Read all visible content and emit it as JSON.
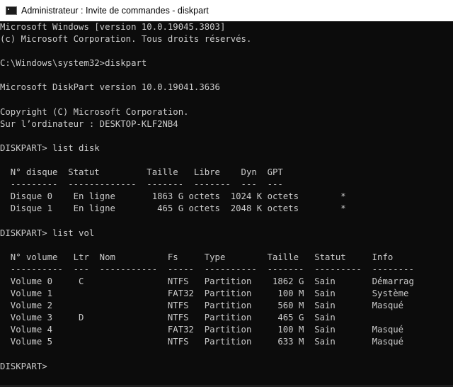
{
  "window": {
    "title": "Administrateur : Invite de commandes - diskpart",
    "icon": "cmd-icon"
  },
  "console": {
    "lines": [
      "Microsoft Windows [version 10.0.19045.3803]",
      "(c) Microsoft Corporation. Tous droits réservés.",
      "",
      "C:\\Windows\\system32>diskpart",
      "",
      "Microsoft DiskPart version 10.0.19041.3636",
      "",
      "Copyright (C) Microsoft Corporation.",
      "Sur l’ordinateur : DESKTOP-KLF2NB4",
      "",
      "DISKPART> list disk",
      "",
      "  N° disque  Statut         Taille   Libre    Dyn  GPT",
      "  ---------  -------------  -------  -------  ---  ---",
      "  Disque 0    En ligne       1863 G octets  1024 K octets        *",
      "  Disque 1    En ligne        465 G octets  2048 K octets        *",
      "",
      "DISKPART> list vol",
      "",
      "  N° volume   Ltr  Nom          Fs     Type        Taille   Statut     Info",
      "  ----------  ---  -----------  -----  ----------  -------  ---------  --------",
      "  Volume 0     C                NTFS   Partition    1862 G  Sain       Démarrag",
      "  Volume 1                      FAT32  Partition     100 M  Sain       Système",
      "  Volume 2                      NTFS   Partition     560 M  Sain       Masqué",
      "  Volume 3     D                NTFS   Partition     465 G  Sain",
      "  Volume 4                      FAT32  Partition     100 M  Sain       Masqué",
      "  Volume 5                      NTFS   Partition     633 M  Sain       Masqué",
      "",
      "DISKPART>"
    ]
  }
}
